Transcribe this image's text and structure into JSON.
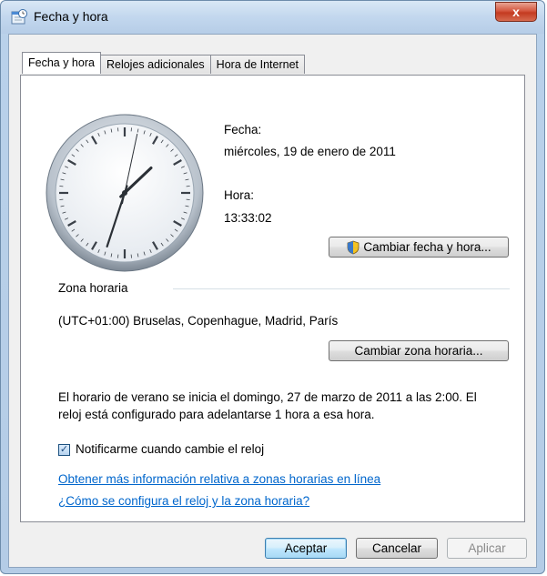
{
  "window": {
    "title": "Fecha y hora",
    "close_label": "x",
    "icon": "date-time-icon"
  },
  "tabs": [
    {
      "label": "Fecha y hora",
      "active": true
    },
    {
      "label": "Relojes adicionales",
      "active": false
    },
    {
      "label": "Hora de Internet",
      "active": false
    }
  ],
  "clock": {
    "hours": 13,
    "minutes": 33,
    "seconds": 2
  },
  "date": {
    "label": "Fecha:",
    "value": "miércoles, 19 de enero de 2011"
  },
  "time": {
    "label": "Hora:",
    "value": "13:33:02"
  },
  "buttons": {
    "change_datetime": "Cambiar fecha y hora...",
    "change_timezone": "Cambiar zona horaria...",
    "ok": "Aceptar",
    "cancel": "Cancelar",
    "apply": "Aplicar"
  },
  "timezone": {
    "group_label": "Zona horaria",
    "value": "(UTC+01:00) Bruselas, Copenhague, Madrid, París"
  },
  "dst_text": {
    "line1": "El horario de verano se inicia el domingo, 27 de marzo de 2011 a las 2:00. El",
    "line2": "reloj está configurado para adelantarse 1 hora a esa hora."
  },
  "notify": {
    "label": "Notificarme cuando cambie el reloj",
    "checked": true
  },
  "links": {
    "more_info": "Obtener más información relativa a zonas horarias en línea",
    "how_to": "¿Cómo se configura el reloj y la zona horaria?"
  },
  "colors": {
    "link": "#0066cc",
    "close_button": "#c43a20",
    "accent": "#3c7fb1"
  }
}
